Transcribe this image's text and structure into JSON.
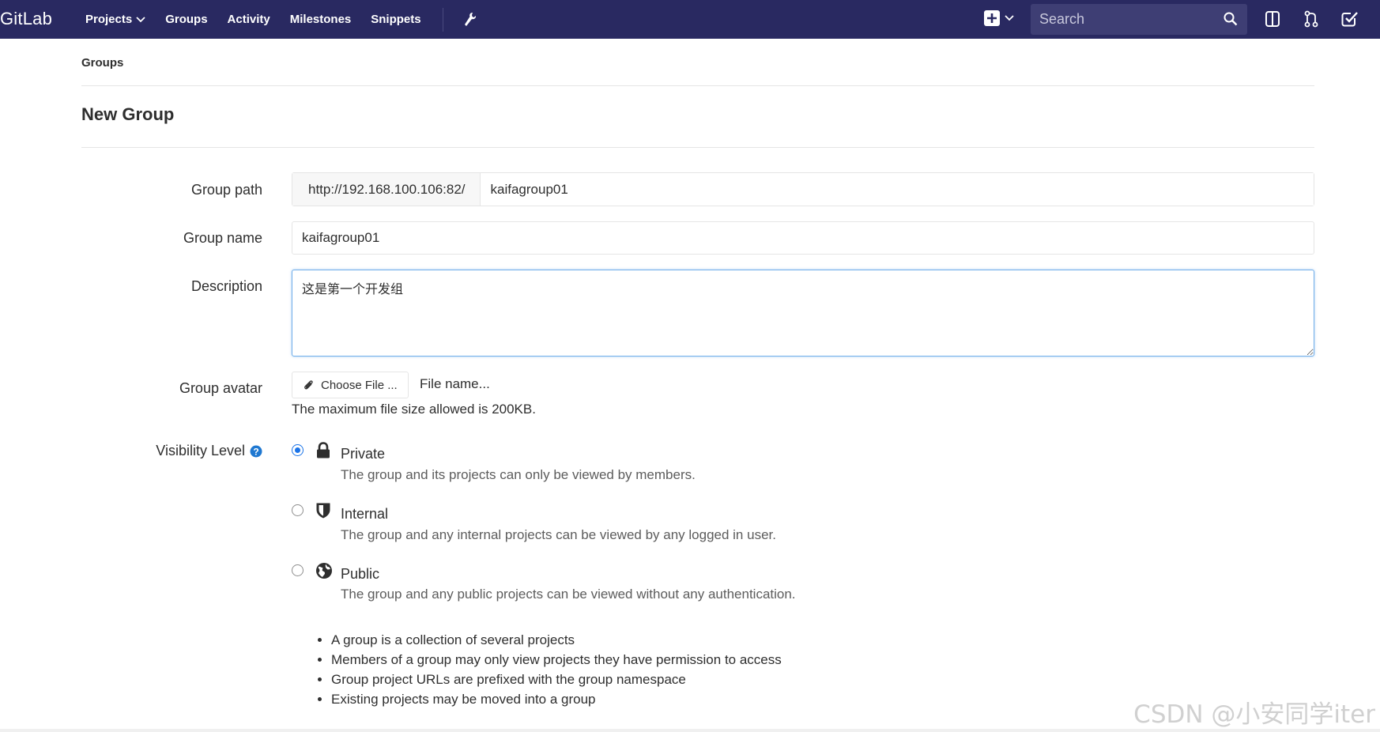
{
  "navbar": {
    "logo": "GitLab",
    "links": [
      "Projects",
      "Groups",
      "Activity",
      "Milestones",
      "Snippets"
    ],
    "search_placeholder": "Search",
    "icons": [
      "plus-square-icon",
      "chevron-down-icon",
      "search-icon",
      "issues-icon",
      "merge-request-icon",
      "todos-check-icon",
      "wrench-icon"
    ],
    "bg_color": "#292961"
  },
  "breadcrumb": "Groups",
  "page_title": "New Group",
  "form": {
    "group_path_label": "Group path",
    "group_path_prefix": "http://192.168.100.106:82/",
    "group_path_value": "kaifagroup01",
    "group_name_label": "Group name",
    "group_name_value": "kaifagroup01",
    "description_label": "Description",
    "description_value": "这是第一个开发组",
    "avatar_label": "Group avatar",
    "choose_file_label": "Choose File ...",
    "file_name": "File name...",
    "file_help": "The maximum file size allowed is 200KB.",
    "visibility_label": "Visibility Level",
    "visibility_options": [
      {
        "title": "Private",
        "desc": "The group and its projects can only be viewed by members.",
        "checked": true,
        "icon": "lock-icon"
      },
      {
        "title": "Internal",
        "desc": "The group and any internal projects can be viewed by any logged in user.",
        "checked": false,
        "icon": "shield-icon"
      },
      {
        "title": "Public",
        "desc": "The group and any public projects can be viewed without any authentication.",
        "checked": false,
        "icon": "globe-icon"
      }
    ]
  },
  "help_items": [
    "A group is a collection of several projects",
    "Members of a group may only view projects they have permission to access",
    "Group project URLs are prefixed with the group namespace",
    "Existing projects may be moved into a group"
  ],
  "watermark": "CSDN @小安同学iter"
}
